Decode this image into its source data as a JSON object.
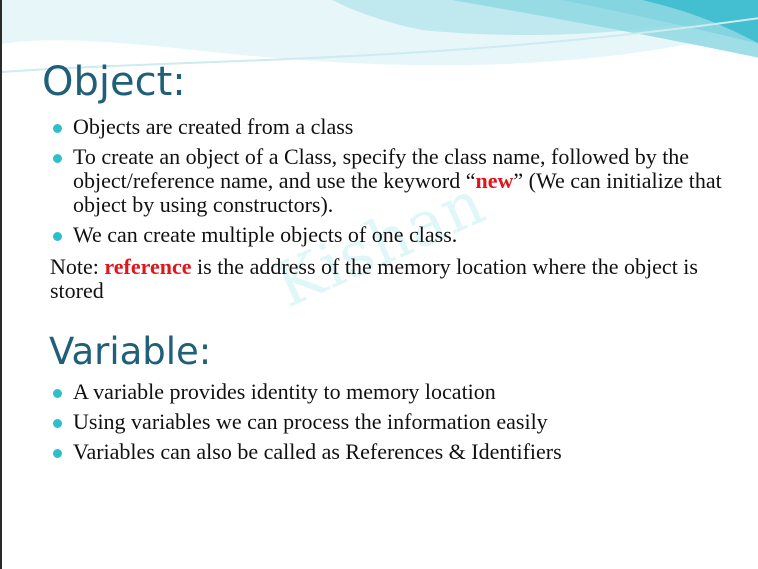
{
  "accent_color": "#2fbfcb",
  "heading_color": "#1f5f7a",
  "keyword_color": "#e0161b",
  "watermark": "Kishan",
  "object_section": {
    "title": "Object:",
    "bullets": [
      {
        "text": "Objects are created from a class"
      },
      {
        "text_before": "To create an object of a Class, specify the class name, followed by the object/reference name, and use the keyword “",
        "keyword": "new",
        "text_after": "” (We can initialize that object by using constructors)."
      },
      {
        "text": "We can create multiple objects of one class."
      }
    ],
    "note": {
      "prefix": "Note: ",
      "keyword": "reference",
      "suffix": " is the address of the memory location where the object is stored"
    }
  },
  "variable_section": {
    "title": "Variable:",
    "bullets": [
      {
        "text": "A variable provides identity to memory location"
      },
      {
        "text": "Using variables we can process the information easily"
      },
      {
        "text": "Variables can also be called as References & Identifiers"
      }
    ]
  }
}
